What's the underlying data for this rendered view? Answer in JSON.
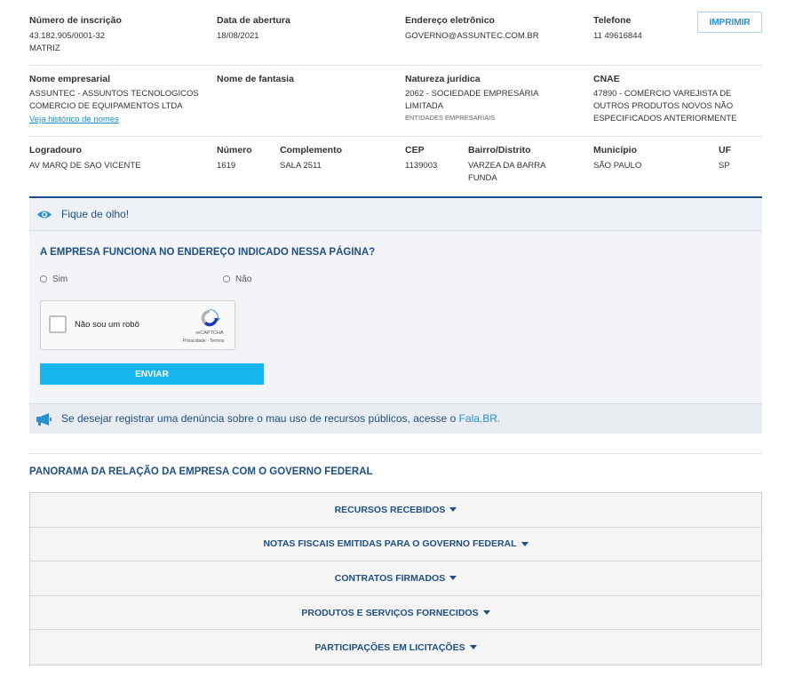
{
  "row1": {
    "inscricao_label": "Número de inscrição",
    "inscricao_value": "43.182.905/0001-32",
    "inscricao_type": "MATRIZ",
    "abertura_label": "Data de abertura",
    "abertura_value": "18/08/2021",
    "email_label": "Endereço eletrônico",
    "email_value": "GOVERNO@ASSUNTEC.COM.BR",
    "telefone_label": "Telefone",
    "telefone_value": "11 49616844",
    "print_label": "IMPRIMIR"
  },
  "row2": {
    "nome_label": "Nome empresarial",
    "nome_value": "ASSUNTEC - ASSUNTOS TECNOLOGICOS COMERCIO DE EQUIPAMENTOS LTDA",
    "historico_link": "Veja histórico de nomes",
    "fantasia_label": "Nome de fantasia",
    "natureza_label": "Natureza jurídica",
    "natureza_value": "2062 - SOCIEDADE EMPRESÁRIA LIMITADA",
    "natureza_sub": "ENTIDADES EMPRESARIAIS",
    "cnae_label": "CNAE",
    "cnae_value": "47890 - COMÉRCIO VAREJISTA DE OUTROS PRODUTOS NOVOS NÃO ESPECIFICADOS ANTERIORMENTE"
  },
  "row3": {
    "logradouro_label": "Logradouro",
    "logradouro_value": "AV MARQ DE SAO VICENTE",
    "numero_label": "Número",
    "numero_value": "1619",
    "complemento_label": "Complemento",
    "complemento_value": "SALA 2511",
    "cep_label": "CEP",
    "cep_value": "1139003",
    "bairro_label": "Bairro/Distrito",
    "bairro_value": "VARZEA DA BARRA FUNDA",
    "municipio_label": "Município",
    "municipio_value": "SÃO PAULO",
    "uf_label": "UF",
    "uf_value": "SP"
  },
  "alert": {
    "title": "Fique de olho!",
    "question": "A EMPRESA FUNCIONA NO ENDEREÇO INDICADO NESSA PÁGINA?",
    "option_yes": "Sim",
    "option_no": "Não",
    "captcha_label": "Não sou um robô",
    "captcha_brand": "reCAPTCHA",
    "captcha_terms": "Privacidade - Termos",
    "send_label": "ENVIAR"
  },
  "report": {
    "text": "Se desejar registrar uma denúncia sobre o mau uso de recursos públicos, acesse o ",
    "link": "Fala.BR."
  },
  "panorama": {
    "title": "PANORAMA DA RELAÇÃO DA EMPRESA COM O GOVERNO FEDERAL",
    "items": [
      "RECURSOS RECEBIDOS",
      "NOTAS FISCAIS EMITIDAS PARA O GOVERNO FEDERAL",
      "CONTRATOS FIRMADOS",
      "PRODUTOS E SERVIÇOS FORNECIDOS",
      "PARTICIPAÇÕES EM LICITAÇÕES"
    ]
  },
  "colors": {
    "primary_blue": "#1f4f85",
    "accent_blue": "#19b5f0",
    "link_blue": "#1a8ccf"
  }
}
